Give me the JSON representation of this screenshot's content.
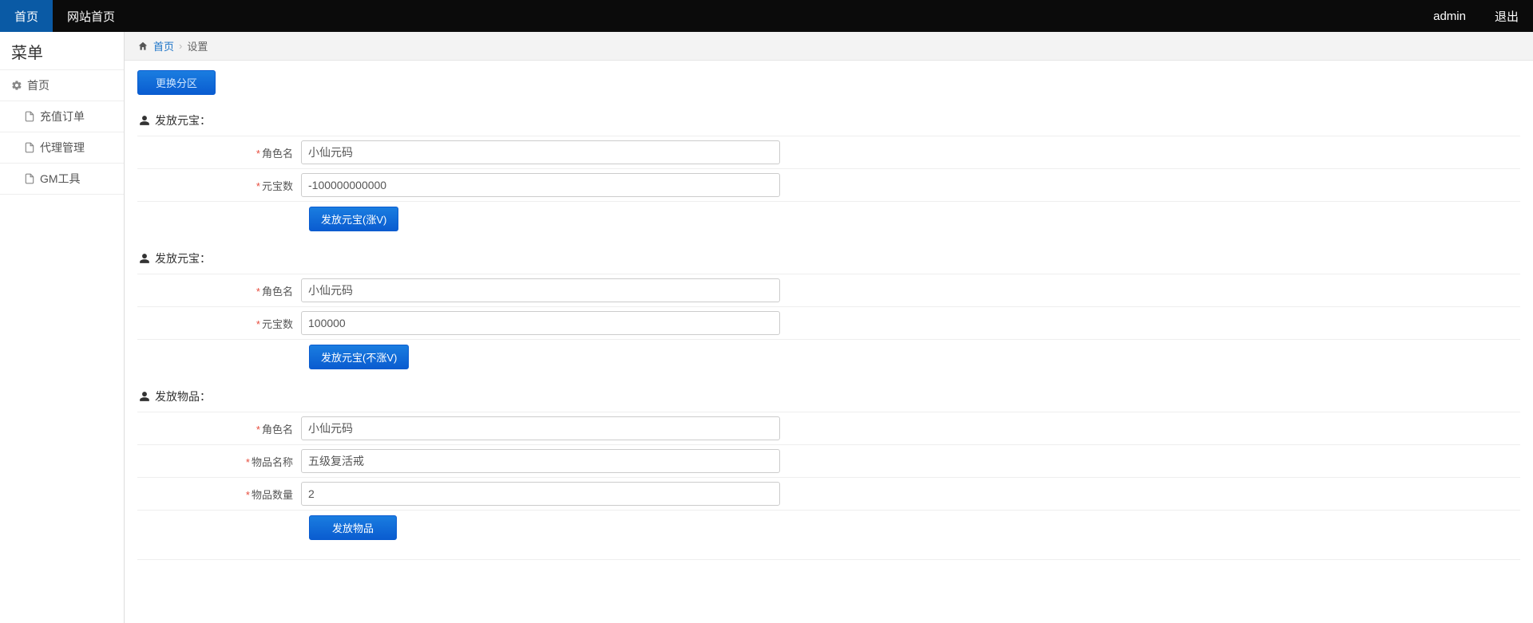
{
  "topnav": {
    "left": [
      {
        "label": "首页",
        "active": true
      },
      {
        "label": "网站首页",
        "active": false
      }
    ],
    "right": [
      {
        "label": "admin"
      },
      {
        "label": "退出"
      }
    ]
  },
  "sidebar": {
    "title": "菜单",
    "root": {
      "label": "首页"
    },
    "items": [
      {
        "label": "充值订单"
      },
      {
        "label": "代理管理"
      },
      {
        "label": "GM工具"
      }
    ]
  },
  "breadcrumb": {
    "home": "首页",
    "current": "设置"
  },
  "zone_button": "更换分区",
  "sections": {
    "yuanbao1": {
      "title": "发放元宝：",
      "role_label": "角色名",
      "role_value": "小仙元码",
      "amount_label": "元宝数",
      "amount_value": "-100000000000",
      "button": "发放元宝(涨V)"
    },
    "yuanbao2": {
      "title": "发放元宝：",
      "role_label": "角色名",
      "role_value": "小仙元码",
      "amount_label": "元宝数",
      "amount_value": "100000",
      "button": "发放元宝(不涨V)"
    },
    "item": {
      "title": "发放物品：",
      "role_label": "角色名",
      "role_value": "小仙元码",
      "name_label": "物品名称",
      "name_value": "五级复活戒",
      "qty_label": "物品数量",
      "qty_value": "2",
      "button": "发放物品"
    }
  }
}
